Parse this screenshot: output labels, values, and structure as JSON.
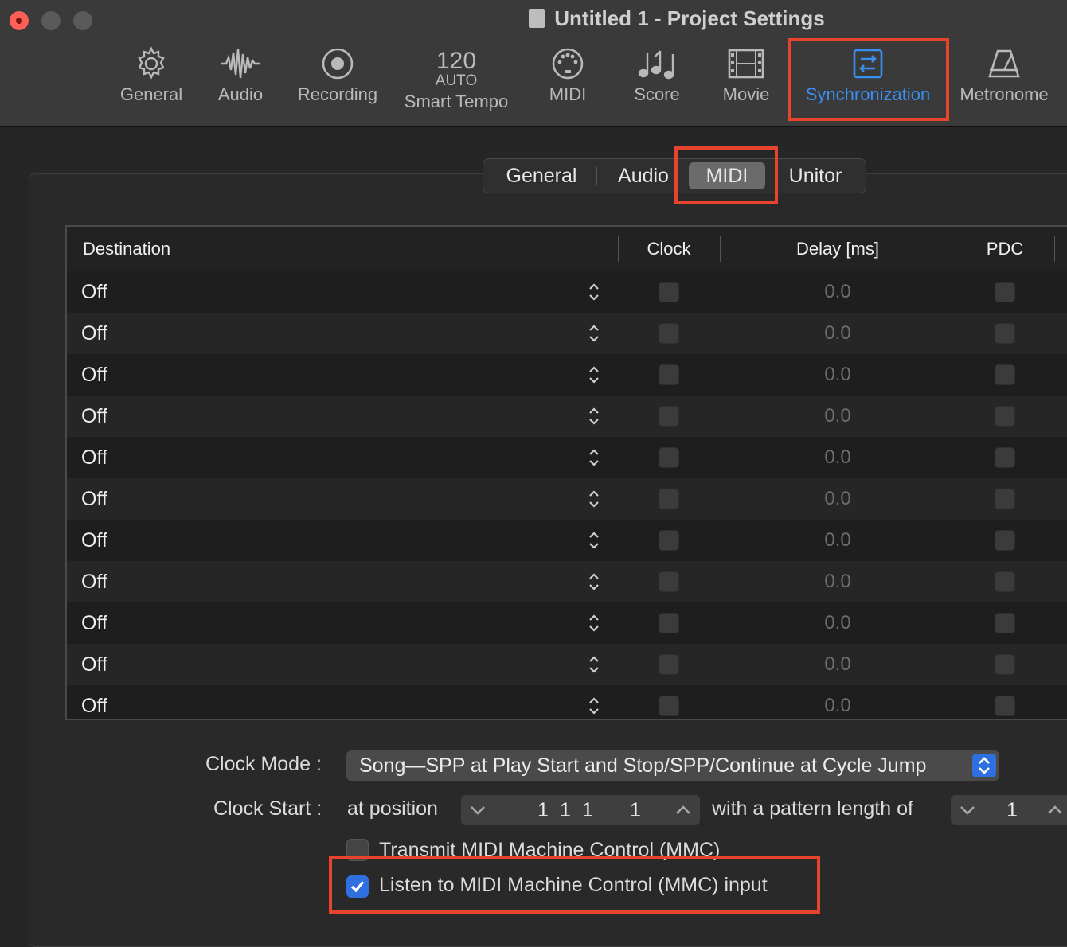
{
  "window": {
    "title": "Untitled 1 - Project Settings"
  },
  "toolbar": {
    "items": [
      {
        "label": "General",
        "icon": "gear-icon"
      },
      {
        "label": "Audio",
        "icon": "waveform-icon"
      },
      {
        "label": "Recording",
        "icon": "record-icon"
      },
      {
        "label": "Smart Tempo",
        "tempo_value": "120",
        "tempo_mode": "AUTO"
      },
      {
        "label": "MIDI",
        "icon": "midi-port-icon"
      },
      {
        "label": "Score",
        "icon": "notes-icon"
      },
      {
        "label": "Movie",
        "icon": "film-icon"
      },
      {
        "label": "Synchronization",
        "icon": "sync-icon",
        "selected": true
      },
      {
        "label": "Metronome",
        "icon": "metronome-icon"
      }
    ],
    "accent": "#3b8ff0"
  },
  "subtabs": {
    "items": [
      "General",
      "Audio",
      "MIDI",
      "Unitor"
    ],
    "selected": "MIDI"
  },
  "table": {
    "headers": {
      "destination": "Destination",
      "clock": "Clock",
      "delay": "Delay [ms]",
      "pdc": "PDC"
    },
    "rows": [
      {
        "destination": "Off",
        "clock": false,
        "delay": "0.0",
        "pdc": false
      },
      {
        "destination": "Off",
        "clock": false,
        "delay": "0.0",
        "pdc": false
      },
      {
        "destination": "Off",
        "clock": false,
        "delay": "0.0",
        "pdc": false
      },
      {
        "destination": "Off",
        "clock": false,
        "delay": "0.0",
        "pdc": false
      },
      {
        "destination": "Off",
        "clock": false,
        "delay": "0.0",
        "pdc": false
      },
      {
        "destination": "Off",
        "clock": false,
        "delay": "0.0",
        "pdc": false
      },
      {
        "destination": "Off",
        "clock": false,
        "delay": "0.0",
        "pdc": false
      },
      {
        "destination": "Off",
        "clock": false,
        "delay": "0.0",
        "pdc": false
      },
      {
        "destination": "Off",
        "clock": false,
        "delay": "0.0",
        "pdc": false
      },
      {
        "destination": "Off",
        "clock": false,
        "delay": "0.0",
        "pdc": false
      },
      {
        "destination": "Off",
        "clock": false,
        "delay": "0.0",
        "pdc": false
      }
    ]
  },
  "clock_mode": {
    "label": "Clock Mode :",
    "value": "Song—SPP at Play Start and Stop/SPP/Continue at Cycle Jump"
  },
  "clock_start": {
    "label": "Clock Start :",
    "at_position_label": "at position",
    "position": [
      "1",
      "1",
      "1",
      "1"
    ],
    "pattern_label": "with a pattern length of",
    "pattern_length": "1"
  },
  "transmit_mmc": {
    "label": "Transmit MIDI Machine Control (MMC)",
    "checked": false
  },
  "listen_mmc": {
    "label": "Listen to MIDI Machine Control (MMC) input",
    "checked": true
  },
  "colors": {
    "highlight_box": "#e8442d",
    "checkbox_on": "#2f6fe0"
  }
}
